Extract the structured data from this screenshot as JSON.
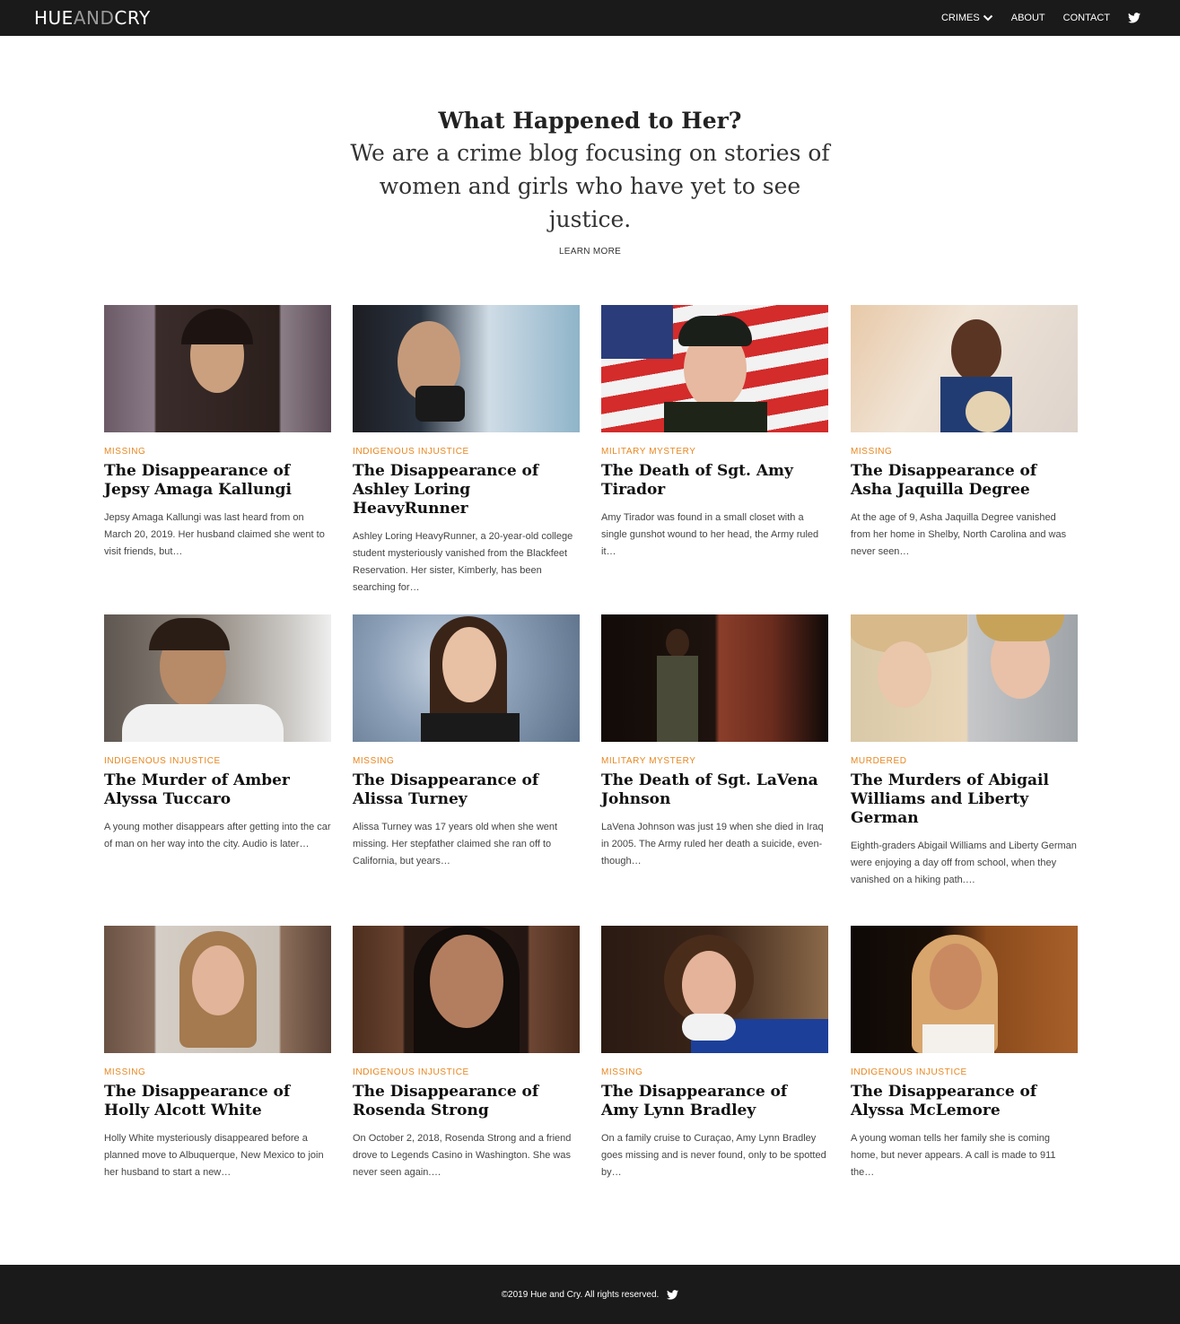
{
  "header": {
    "logo": {
      "part1": "HUE",
      "part2": "AND",
      "part3": "CRY"
    },
    "nav": [
      {
        "label": "CRIMES",
        "has_dropdown": true
      },
      {
        "label": "ABOUT"
      },
      {
        "label": "CONTACT"
      }
    ],
    "twitter_icon": "twitter-icon"
  },
  "hero": {
    "title": "What Happened to Her?",
    "subtitle": "We are a crime blog focusing on stories of women and girls who have yet to see justice.",
    "cta": "LEARN MORE"
  },
  "colors": {
    "accent": "#e8861f",
    "dark": "#1a1a1a"
  },
  "posts": [
    {
      "category": "MISSING",
      "title": "The Disappearance of Jepsy Amaga Kallungi",
      "excerpt": "Jepsy Amaga Kallungi was last heard from on March 20, 2019. Her husband claimed she went to visit friends, but…"
    },
    {
      "category": "INDIGENOUS INJUSTICE",
      "title": "The Disappearance of Ashley Loring HeavyRunner",
      "excerpt": "Ashley Loring HeavyRunner, a 20-year-old college student mysteriously vanished from the Blackfeet Reservation. Her sister, Kimberly, has been searching for…"
    },
    {
      "category": "MILITARY MYSTERY",
      "title": "The Death of Sgt. Amy Tirador",
      "excerpt": "Amy Tirador was found in a small closet with a single gunshot wound to her head, the Army ruled it…"
    },
    {
      "category": "MISSING",
      "title": "The Disappearance of Asha Jaquilla Degree",
      "excerpt": "At the age of 9, Asha Jaquilla Degree vanished from her home in Shelby, North Carolina and was never seen…"
    },
    {
      "category": "INDIGENOUS INJUSTICE",
      "title": "The Murder of Amber Alyssa Tuccaro",
      "excerpt": "A young mother disappears after getting into the car of man on her way into the city. Audio is later…"
    },
    {
      "category": "MISSING",
      "title": "The Disappearance of Alissa Turney",
      "excerpt": "Alissa Turney was 17 years old when she went missing. Her stepfather claimed she ran off to California, but years…"
    },
    {
      "category": "MILITARY MYSTERY",
      "title": "The Death of Sgt. LaVena Johnson",
      "excerpt": "LaVena Johnson was just 19 when she died in Iraq in 2005. The Army ruled her death a suicide, even-though…"
    },
    {
      "category": "MURDERED",
      "title": "The Murders of Abigail Williams and Liberty German",
      "excerpt": "Eighth-graders Abigail Williams and Liberty German were enjoying a day off from school, when they vanished on a hiking path.…"
    },
    {
      "category": "MISSING",
      "title": "The Disappearance of Holly Alcott White",
      "excerpt": "Holly White mysteriously disappeared before a planned move to Albuquerque, New Mexico to join her husband to start a new…"
    },
    {
      "category": "INDIGENOUS INJUSTICE",
      "title": "The Disappearance of Rosenda Strong",
      "excerpt": "On October 2, 2018, Rosenda Strong and a friend drove to Legends Casino in Washington. She was never seen again.…"
    },
    {
      "category": "MISSING",
      "title": "The Disappearance of Amy Lynn Bradley",
      "excerpt": "On a family cruise to Curaçao, Amy Lynn Bradley goes missing and is never found, only to be spotted by…"
    },
    {
      "category": "INDIGENOUS INJUSTICE",
      "title": "The Disappearance of Alyssa McLemore",
      "excerpt": "A young woman tells her family she is coming home, but never appears. A call is made to 911 the…"
    }
  ],
  "footer": {
    "copyright": "©2019 Hue and Cry. All rights reserved.",
    "twitter_icon": "twitter-icon"
  }
}
